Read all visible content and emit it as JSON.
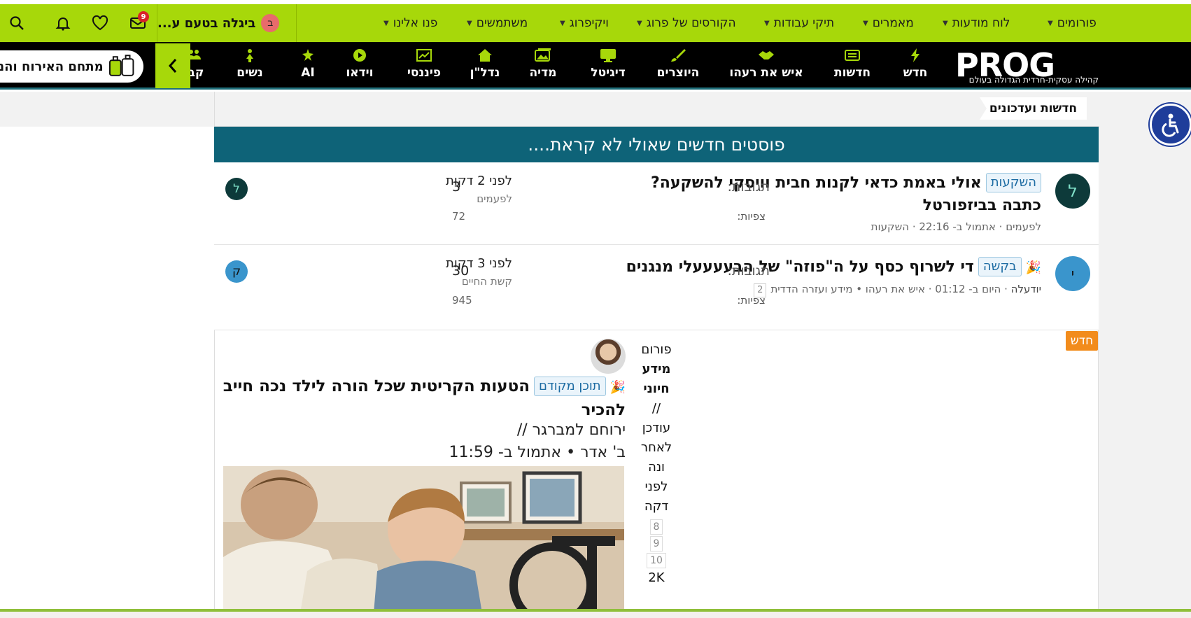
{
  "topnav": {
    "items": [
      {
        "label": "פורומים"
      },
      {
        "label": "לוח מודעות"
      },
      {
        "label": "מאמרים"
      },
      {
        "label": "תיקי עבודות"
      },
      {
        "label": "הקורסים של פרוג"
      },
      {
        "label": "ויקיפרוג"
      },
      {
        "label": "משתמשים"
      },
      {
        "label": "פנו אלינו"
      }
    ],
    "user": {
      "avatar_letter": "ב",
      "name": "ביגלה בטעם ע..."
    },
    "inbox_count": "9",
    "icons": [
      "inbox-icon",
      "heart-icon",
      "bell-icon",
      "search-icon"
    ]
  },
  "brand": {
    "logo_text": "PROG",
    "tagline": "קהילה עסקית-חרדית הגדולה בעולם"
  },
  "categories": [
    {
      "label": "חדש",
      "icon": "bolt-icon"
    },
    {
      "label": "חדשות",
      "icon": "news-icon"
    },
    {
      "label": "איש את רעהו",
      "icon": "handshake-icon"
    },
    {
      "label": "היוצרים",
      "icon": "brush-icon"
    },
    {
      "label": "דיגיטל",
      "icon": "monitor-icon"
    },
    {
      "label": "מדיה",
      "icon": "image-icon"
    },
    {
      "label": "נדל\"ן",
      "icon": "house-icon"
    },
    {
      "label": "פיננסי",
      "icon": "chart-icon"
    },
    {
      "label": "וידאו",
      "icon": "play-icon"
    },
    {
      "label": "AI",
      "icon": "sparkle-icon"
    },
    {
      "label": "נשים",
      "icon": "woman-icon"
    },
    {
      "label": "קבו",
      "icon": "group-icon"
    }
  ],
  "promo": {
    "text": "מתחם האירוח והנ"
  },
  "breadcrumb": {
    "label": "חדשות ועדכונים"
  },
  "banner": {
    "title": "פוסטים חדשים שאולי לא קראת...."
  },
  "threads": [
    {
      "avatar_letter": "ל",
      "avatar_color": "#0d3a3a",
      "tag": "השקעות",
      "title": "אולי באמת כדאי לקנות חבית וויסקי להשקעה? כתבה בביזפורטל",
      "meta": "לפעמים · אתמול ב- 22:16 · השקעות",
      "replies_label": "תגובות:",
      "replies": "3",
      "views_label": "צפיות:",
      "views": "72",
      "last_time": "לפני 2 דקות",
      "last_user": "לפעמים",
      "last_avatar_letter": "ל",
      "last_avatar_color": "#0d3a3a"
    },
    {
      "avatar_letter": "י",
      "avatar_color": "#3a95cc",
      "tag": "בקשה",
      "title": "די לשרוף כסף על ה\"פוזה\" של הבעעעעלי מנגנים",
      "meta_user": "יודעלה",
      "meta_rest": " · היום ב- 01:12 · איש את רעהו • מידע ועזרה הדדית",
      "page_num": "2",
      "replies_label": "תגובות:",
      "replies": "30",
      "views_label": "צפיות:",
      "views": "945",
      "last_time": "לפני 3 דקות",
      "last_user": "קשת החיים",
      "last_avatar_letter": "ק",
      "last_avatar_color": "#3a95cc"
    }
  ],
  "new_post": {
    "badge": "חדש",
    "forum_lines": [
      "פורום"
    ],
    "forum_bold": [
      "מידע",
      "חיוני"
    ],
    "forum_rest": [
      "//",
      "עודכן",
      "לאחר",
      "ונה",
      "לפני",
      "דקה"
    ],
    "pages": [
      "8",
      "9",
      "10"
    ],
    "count": "2K",
    "tag": "תוכן מקודם",
    "title": "הטעות הקריטית שכל הורה לילד נכה חייב להכיר",
    "author": "ירוחם למברגר //",
    "time": "ב' אדר • אתמול ב- 11:59"
  }
}
